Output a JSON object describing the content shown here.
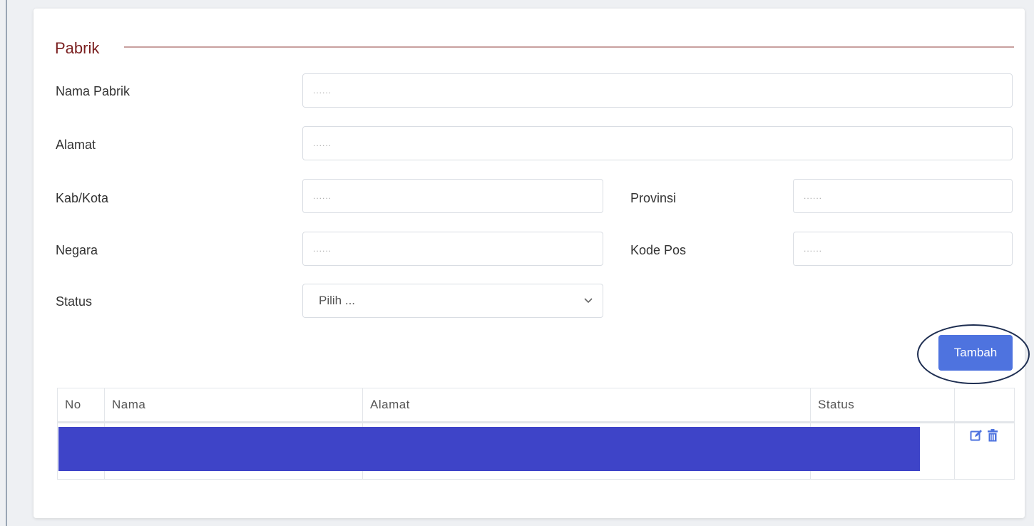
{
  "form": {
    "section_title": "Pabrik",
    "nama_pabrik": {
      "label": "Nama Pabrik",
      "placeholder": "......",
      "value": ""
    },
    "alamat": {
      "label": "Alamat",
      "placeholder": "......",
      "value": ""
    },
    "kab_kota": {
      "label": "Kab/Kota",
      "placeholder": "......",
      "value": ""
    },
    "provinsi": {
      "label": "Provinsi",
      "placeholder": "......",
      "value": ""
    },
    "negara": {
      "label": "Negara",
      "placeholder": "......",
      "value": ""
    },
    "kode_pos": {
      "label": "Kode Pos",
      "placeholder": "......",
      "value": ""
    },
    "status": {
      "label": "Status",
      "selected": "Pilih ..."
    },
    "add_button_label": "Tambah"
  },
  "table": {
    "columns": [
      "No",
      "Nama",
      "Alamat",
      "Status",
      ""
    ],
    "rows": [
      {
        "no": "",
        "nama": "",
        "alamat": "",
        "status": ""
      }
    ],
    "row_actions": [
      "edit-icon",
      "trash-icon"
    ]
  },
  "colors": {
    "section_title": "#7a1f1f",
    "section_line": "#c9a09f",
    "primary_button": "#4e73df",
    "redaction_block": "#3e44c8",
    "circle_annotation": "#1f2f52"
  }
}
